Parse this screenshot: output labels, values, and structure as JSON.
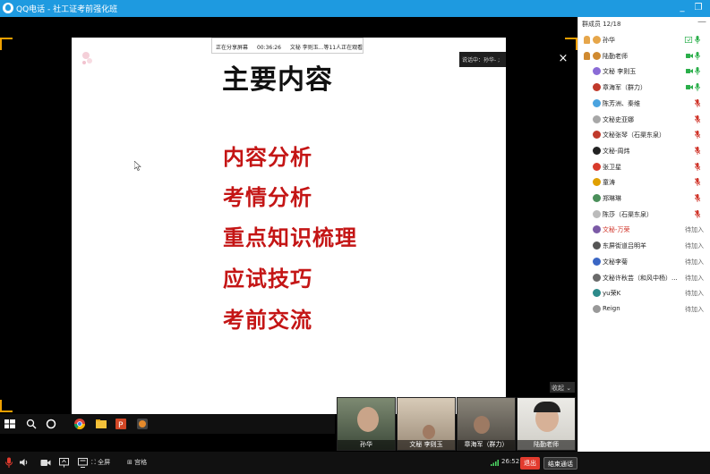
{
  "window": {
    "title": "QQ电话 - 社工证考前强化班",
    "minimize": "_",
    "restore": "❐",
    "close": "✕"
  },
  "slide": {
    "share_status": "正在分享屏幕",
    "share_time": "00:36:26",
    "viewers_text": "文秘 李则玉...等11人正在观看",
    "title": "主要内容",
    "items": [
      "内容分析",
      "考情分析",
      "重点知识梳理",
      "应试技巧",
      "考前交流"
    ]
  },
  "speaking_label": "说话中：孙华- ;",
  "close_label": "×",
  "collapse_label": "收起",
  "video_thumbs": [
    {
      "name": "孙华",
      "bg": "#5a6b55"
    },
    {
      "name": "文秘 李则玉",
      "bg": "#b9a894"
    },
    {
      "name": "章海军（群力）",
      "bg": "#6e6a5f"
    },
    {
      "name": "陆勤老师",
      "bg": "#d8d6d0"
    }
  ],
  "members": {
    "header": "群成员 12/18",
    "list": [
      {
        "name": "孙华",
        "status": "",
        "color": "#e6a64a",
        "state": "speaking"
      },
      {
        "name": "陆勤老师",
        "status": "",
        "color": "#d08a30",
        "state": "cam"
      },
      {
        "name": "文秘 李则玉",
        "status": "",
        "color": "#8a6bd6",
        "state": "cam"
      },
      {
        "name": "章海军（群力）",
        "status": "",
        "color": "#c0392b",
        "state": "cam"
      },
      {
        "name": "陈芳洲、秦维",
        "status": "",
        "color": "#4aa3df",
        "state": "muted"
      },
      {
        "name": "文秘史亚娜",
        "status": "",
        "color": "#a7a7a7",
        "state": "muted"
      },
      {
        "name": "文秘张琴（石渠东泉）",
        "status": "",
        "color": "#c0392b",
        "state": "muted"
      },
      {
        "name": "文秘-周炜",
        "status": "",
        "color": "#222222",
        "state": "muted"
      },
      {
        "name": "张卫星",
        "status": "",
        "color": "#d83b2b",
        "state": "muted"
      },
      {
        "name": "童涛",
        "status": "",
        "color": "#e0a000",
        "state": "muted"
      },
      {
        "name": "郑琳琳",
        "status": "",
        "color": "#4a8f5a",
        "state": "muted"
      },
      {
        "name": "陈莎（石渠东泉）",
        "status": "",
        "color": "#bbbbbb",
        "state": "muted"
      },
      {
        "name": "文秘-万荣",
        "status": "待加入",
        "color": "#7b5aa6",
        "state": "waiting",
        "highlight": true
      },
      {
        "name": "东屏街道吕明羊",
        "status": "待加入",
        "color": "#555555",
        "state": "waiting"
      },
      {
        "name": "文秘李菊",
        "status": "待加入",
        "color": "#3a66c4",
        "state": "waiting"
      },
      {
        "name": "文秘许秋芸（和风中杨）...",
        "status": "待加入",
        "color": "#6a6a6a",
        "state": "waiting"
      },
      {
        "name": "yu荣K",
        "status": "待加入",
        "color": "#2d8a8a",
        "state": "waiting"
      },
      {
        "name": "Reign",
        "status": "待加入",
        "color": "#999999",
        "state": "waiting"
      }
    ]
  },
  "bottom": {
    "fullscreen": "全屏",
    "grid": "宫格",
    "time": "26:52",
    "hangup": "退出",
    "end_call": "结束通话"
  },
  "colors": {
    "accent": "#1e9ae0",
    "slide_red": "#c41515",
    "hangup": "#e23b2e",
    "corner": "#f0a000"
  }
}
